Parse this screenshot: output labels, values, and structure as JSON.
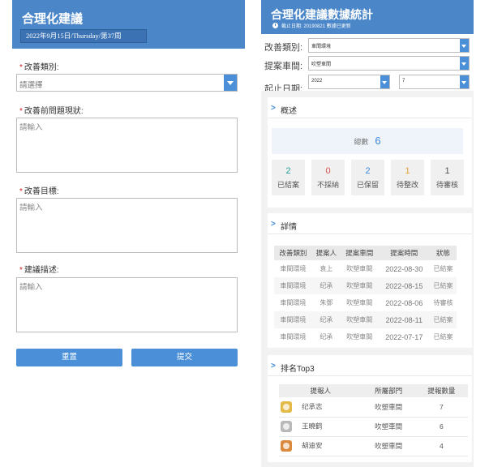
{
  "form": {
    "title": "合理化建議",
    "date": "2022年9月15日/Thursday/第37周",
    "required_mark": "*",
    "category_label": "改善類別:",
    "category_placeholder": "請選擇",
    "current_label": "改善前問題現狀:",
    "current_placeholder": "請輸入",
    "goal_label": "改善目標:",
    "goal_placeholder": "請輸入",
    "desc_label": "建議描述:",
    "desc_placeholder": "請輸入",
    "reset_label": "重置",
    "submit_label": "提交"
  },
  "stats": {
    "title": "合理化建議數據統計",
    "subtitle": "截止日期: 20190821 數據已更新",
    "filters": {
      "category_label": "改善類別:",
      "category_value": "車間環境",
      "workshop_label": "提案車間:",
      "workshop_value": "吹塑車間",
      "date_label": "起止日期:",
      "year_value": "2022",
      "month_value": "7"
    },
    "overview": {
      "title": "概述",
      "total_label": "總數",
      "total": "6",
      "items": [
        {
          "count": "2",
          "label": "已結案",
          "color": "#2aa198"
        },
        {
          "count": "0",
          "label": "不採納",
          "color": "#d9534f"
        },
        {
          "count": "2",
          "label": "已保留",
          "color": "#3c8ad8"
        },
        {
          "count": "1",
          "label": "待整改",
          "color": "#e8a13c"
        },
        {
          "count": "1",
          "label": "待審核",
          "color": "#555555"
        }
      ]
    },
    "details": {
      "title": "詳情",
      "columns": [
        "改善類別",
        "提案人",
        "提案車間",
        "提案時間",
        "狀態"
      ],
      "rows": [
        [
          "車間環境",
          "袁上",
          "吹塑車間",
          "2022-08-30",
          "已結案"
        ],
        [
          "車間環境",
          "纪承",
          "吹塑車間",
          "2022-08-15",
          "已結案"
        ],
        [
          "車間環境",
          "朱鄧",
          "吹塑車間",
          "2022-08-06",
          "待審核"
        ],
        [
          "車間環境",
          "纪承",
          "吹塑車間",
          "2022-08-11",
          "已結案"
        ],
        [
          "車間環境",
          "纪承",
          "吹塑車間",
          "2022-07-17",
          "已結案"
        ]
      ]
    },
    "ranking": {
      "title": "排名Top3",
      "columns": [
        "提報人",
        "所屬部門",
        "提報數量"
      ],
      "rows": [
        {
          "name": "纪承志",
          "dept": "吹塑車間",
          "count": "7",
          "medal_color": "#e3b948"
        },
        {
          "name": "王曉鹤",
          "dept": "吹塑車間",
          "count": "6",
          "medal_color": "#b9b9b9"
        },
        {
          "name": "胡迪安",
          "dept": "吹塑車間",
          "count": "4",
          "medal_color": "#d98a3c"
        }
      ]
    }
  }
}
